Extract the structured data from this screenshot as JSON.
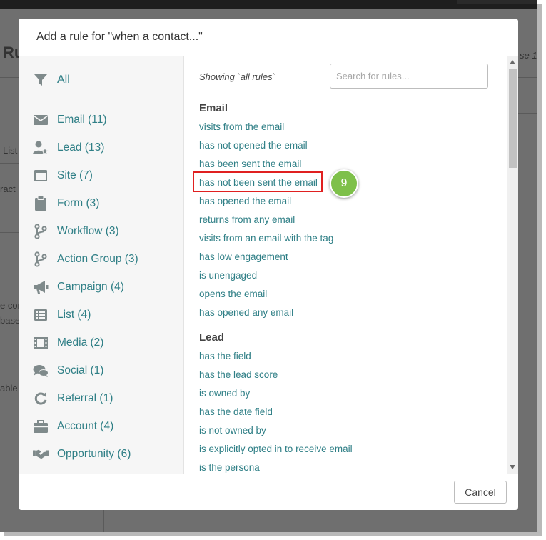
{
  "background": {
    "fragments": [
      {
        "name": "bg-title-fragment",
        "text": "Ru"
      },
      {
        "name": "bg-right-fragment",
        "text": "se 1"
      },
      {
        "name": "bg-list-fragment",
        "text": "List"
      },
      {
        "name": "bg-fragment-1",
        "text": "ract"
      },
      {
        "name": "bg-fragment-2",
        "text": "e con"
      },
      {
        "name": "bg-fragment-3",
        "text": "base"
      },
      {
        "name": "bg-fragment-4",
        "text": "able"
      }
    ]
  },
  "modal": {
    "title": "Add a rule for \"when a contact...\"",
    "cancel_label": "Cancel"
  },
  "sidebar": {
    "all_label": "All",
    "categories": [
      {
        "label": "Email (11)",
        "icon": "envelope-icon"
      },
      {
        "label": "Lead (13)",
        "icon": "lead-user-star-icon"
      },
      {
        "label": "Site (7)",
        "icon": "browser-window-icon"
      },
      {
        "label": "Form (3)",
        "icon": "clipboard-icon"
      },
      {
        "label": "Workflow (3)",
        "icon": "branch-icon"
      },
      {
        "label": "Action Group (3)",
        "icon": "branch-icon"
      },
      {
        "label": "Campaign (4)",
        "icon": "megaphone-icon"
      },
      {
        "label": "List (4)",
        "icon": "list-icon"
      },
      {
        "label": "Media (2)",
        "icon": "film-icon"
      },
      {
        "label": "Social (1)",
        "icon": "chat-bubbles-icon"
      },
      {
        "label": "Referral (1)",
        "icon": "refresh-icon"
      },
      {
        "label": "Account (4)",
        "icon": "briefcase-icon"
      },
      {
        "label": "Opportunity (6)",
        "icon": "handshake-icon"
      }
    ]
  },
  "content": {
    "showing": "Showing `all rules`",
    "search_placeholder": "Search for rules...",
    "groups": [
      {
        "title": "Email",
        "rules": [
          "visits from the email",
          "has not opened the email",
          "has been sent the email",
          "has not been sent the email",
          "has opened the email",
          "returns from any email",
          "visits from an email with the tag",
          "has low engagement",
          "is unengaged",
          "opens the email",
          "has opened any email"
        ]
      },
      {
        "title": "Lead",
        "rules": [
          "has the field",
          "has the lead score",
          "is owned by",
          "has the date field",
          "is not owned by",
          "is explicitly opted in to receive email",
          "is the persona"
        ]
      }
    ],
    "highlighted_rule": "has not been sent the email",
    "step_badge": "9"
  },
  "colors": {
    "link": "#2f7f86",
    "highlight_border": "#e02020",
    "badge": "#7ec04a",
    "sidebar_bg": "#f6f6f6"
  }
}
